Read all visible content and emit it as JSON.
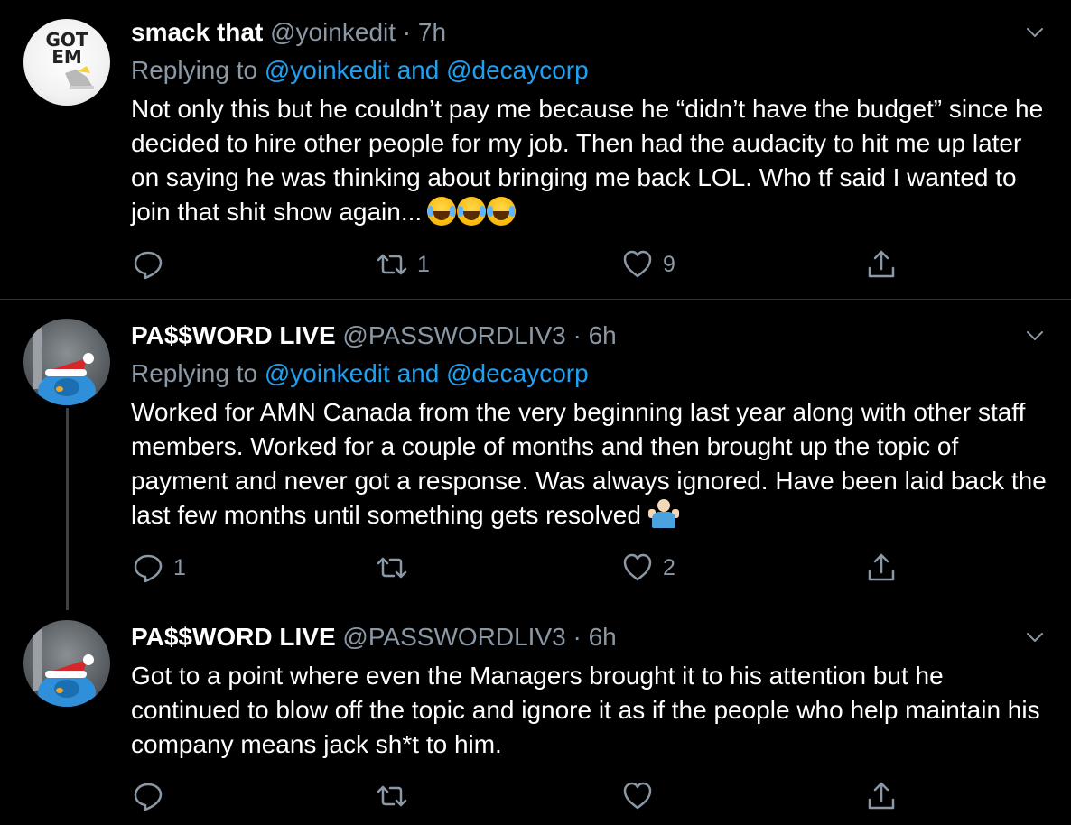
{
  "colors": {
    "background": "#000000",
    "text": "#ffffff",
    "secondary": "#8b98a5",
    "accent_link": "#1da1f2",
    "divider": "#2f3336"
  },
  "tweets": [
    {
      "avatar_text": "GOT\nEM",
      "name": "smack that",
      "handle": "@yoinkedit",
      "sep": "·",
      "time": "7h",
      "replying_prefix": "Replying to",
      "replying_mention_1": "@yoinkedit",
      "replying_and": "and",
      "replying_mention_2": "@decaycorp",
      "text": "Not only this but he couldn’t pay me because he “didn’t have the budget” since he decided to hire other people for my job. Then had the audacity to hit me up later on saying he was thinking about bringing me back LOL. Who tf said I wanted to join that shit show again...",
      "emoji": "face-with-tears-of-joy x3",
      "reply_count": "",
      "retweet_count": "1",
      "like_count": "9"
    },
    {
      "name": "PA$$WORD LIVE",
      "handle": "@PASSWORDLIV3",
      "sep": "·",
      "time": "6h",
      "replying_prefix": "Replying to",
      "replying_mention_1": "@yoinkedit",
      "replying_and": "and",
      "replying_mention_2": "@decaycorp",
      "text": "Worked for AMN Canada from the very beginning last year along with other staff members. Worked for a couple of months and then brought up the topic of payment and never got a response. Was always ignored. Have been laid back the last few months until something gets resolved",
      "emoji": "person-shrugging",
      "reply_count": "1",
      "retweet_count": "",
      "like_count": "2"
    },
    {
      "name": "PA$$WORD LIVE",
      "handle": "@PASSWORDLIV3",
      "sep": "·",
      "time": "6h",
      "text": "Got to a point where even the Managers brought it to his attention but he continued to blow off the topic and ignore it as if the people who help maintain his company means jack sh*t to him.",
      "reply_count": "",
      "retweet_count": "",
      "like_count": ""
    }
  ],
  "icons": {
    "reply": "reply-bubble-icon",
    "retweet": "retweet-icon",
    "like": "heart-icon",
    "share": "share-icon",
    "menu": "chevron-down-icon"
  }
}
